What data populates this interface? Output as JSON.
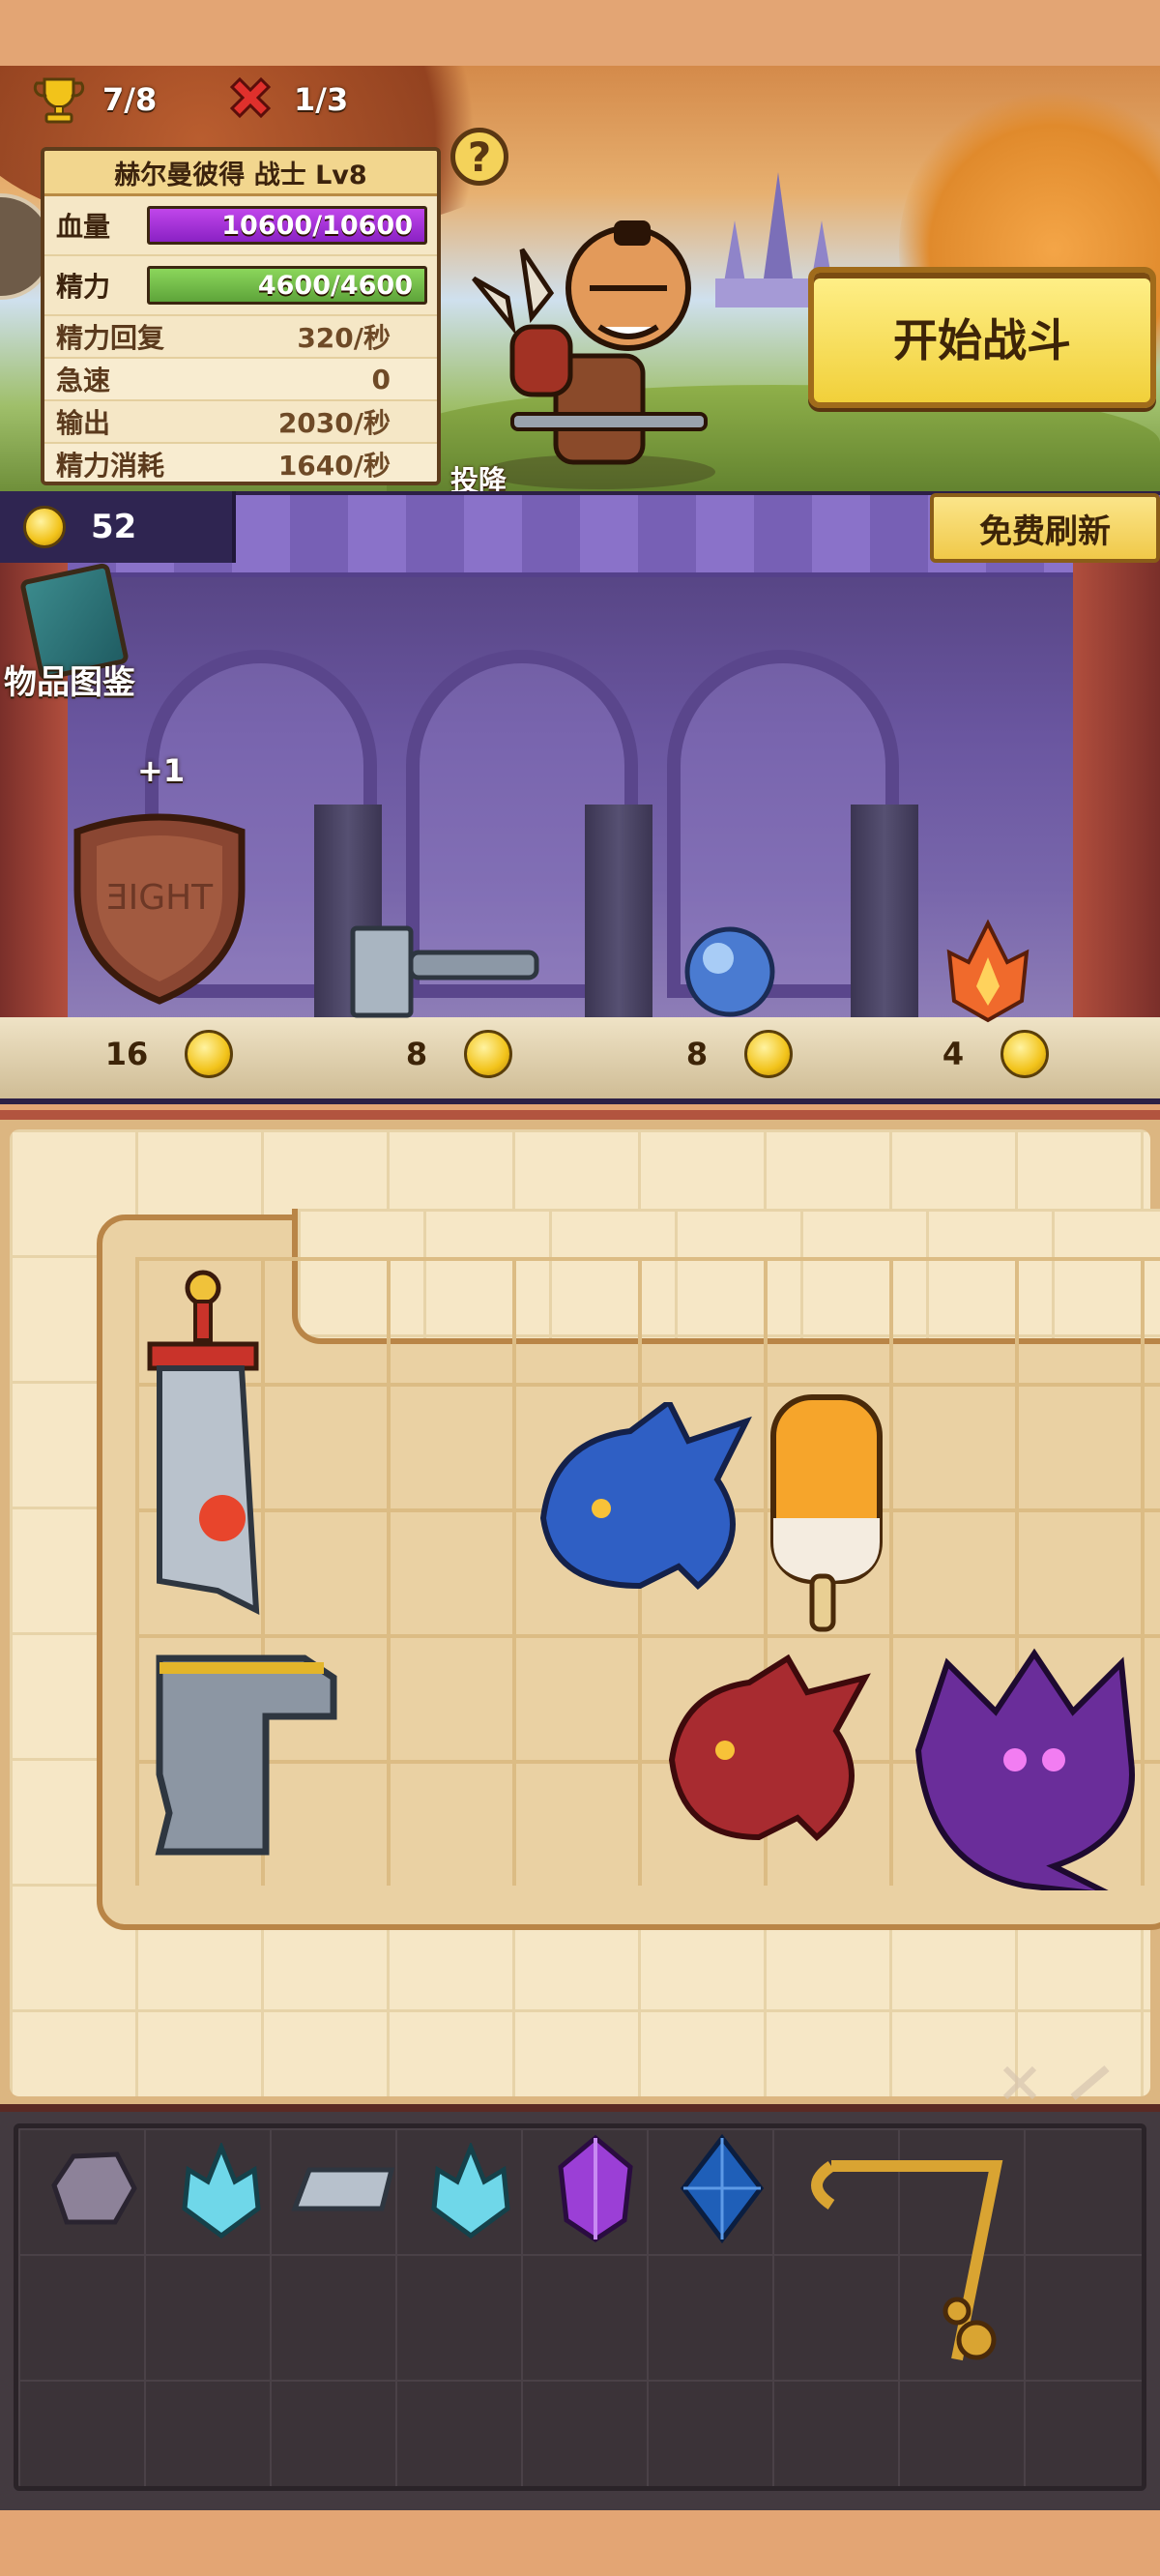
{
  "header": {
    "wins": "7/8",
    "losses": "1/3",
    "help_symbol": "?",
    "surrender_label": "投降",
    "start_battle_label": "开始战斗"
  },
  "hero": {
    "title": "赫尔曼彼得 战士 Lv8",
    "hp_label": "血量",
    "hp_value": "10600/10600",
    "stamina_label": "精力",
    "stamina_value": "4600/4600",
    "stats": [
      {
        "label": "精力回复",
        "value": "320/秒"
      },
      {
        "label": "急速",
        "value": "0"
      },
      {
        "label": "输出",
        "value": "2030/秒"
      },
      {
        "label": "精力消耗",
        "value": "1640/秒"
      }
    ]
  },
  "shop": {
    "gold": "52",
    "free_refresh_label": "免费刷新",
    "codex_label": "物品图鉴",
    "badge": "+1",
    "items": [
      {
        "icon": "wooden-shield-icon",
        "price": "16"
      },
      {
        "icon": "hammer-icon",
        "price": "8"
      },
      {
        "icon": "blue-orb-icon",
        "price": "8"
      },
      {
        "icon": "fire-crystal-icon",
        "price": "4"
      }
    ]
  },
  "backpack": {
    "items": [
      "sword-icon",
      "blue-dragon-icon",
      "popsicle-icon",
      "iron-boot-icon",
      "red-dragon-icon",
      "purple-dragon-icon"
    ]
  },
  "storage": {
    "items": [
      "rough-stone-icon",
      "cyan-crystal-icon",
      "iron-ingot-icon",
      "cyan-crystal-icon",
      "amethyst-icon",
      "sapphire-icon",
      "fishing-rod-icon"
    ]
  },
  "colors": {
    "hp_bar": "#8a21c4",
    "stamina_bar": "#5ea43a",
    "button_yellow": "#f1d03a",
    "shop_purple": "#6a56a0",
    "background_orange": "#e3a574"
  }
}
